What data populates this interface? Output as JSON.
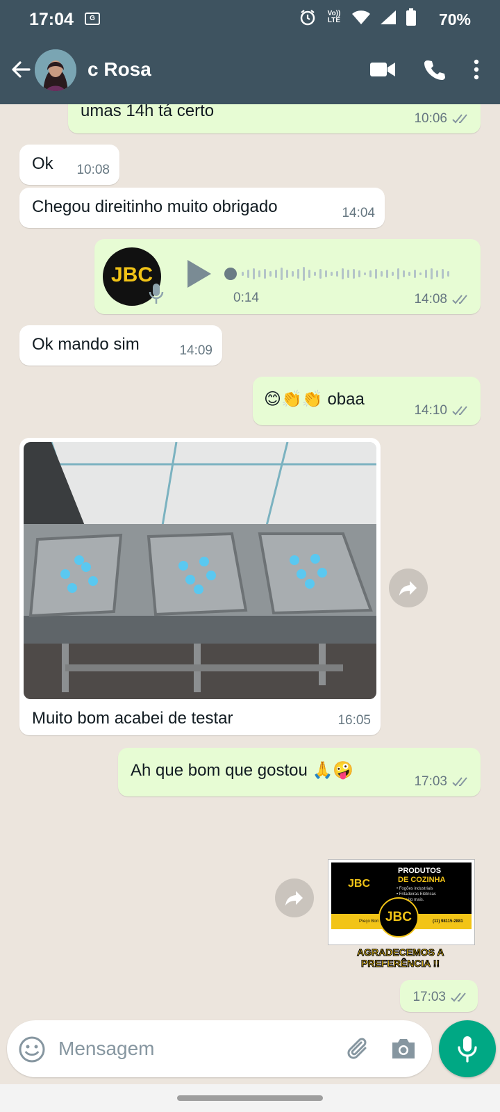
{
  "status_bar": {
    "time": "17:04",
    "battery_percent": "70%",
    "volte_label": "Vo)) LTE"
  },
  "header": {
    "contact_name": "c Rosa"
  },
  "messages": [
    {
      "id": "m1",
      "text": "umas 14h tá certo",
      "time": "10:06"
    },
    {
      "id": "m2",
      "text": "Ok",
      "time": "10:08"
    },
    {
      "id": "m3",
      "text": "Chegou direitinho muito obrigado",
      "time": "14:04"
    },
    {
      "id": "m4",
      "voice_duration": "0:14",
      "time": "14:08",
      "avatar_text": "JBC"
    },
    {
      "id": "m5",
      "text": "Ok mando sim",
      "time": "14:09"
    },
    {
      "id": "m6",
      "text": "😊👏👏 obaa",
      "time": "14:10"
    },
    {
      "id": "m7",
      "caption": "Muito bom acabei de testar",
      "time": "16:05"
    },
    {
      "id": "m8",
      "text": "Ah que bom que gostou 🙏🤪",
      "time": "17:03"
    },
    {
      "id": "m9",
      "sticker": {
        "logo": "JBC",
        "title_line1": "PRODUTOS",
        "title_line2": "DE COZINHA",
        "bullets": [
          "• Fogões industriais",
          "• Fritadeiras Elétricas",
          "• e muito mais."
        ],
        "phone": "(11) 98115-2881",
        "footer_left": "Preço Bom",
        "banner_line1": "AGRADECEMOS A",
        "banner_line2": "PREFERÊNCIA !!"
      }
    },
    {
      "id": "m10",
      "time": "17:03"
    }
  ],
  "composer": {
    "placeholder": "Mensagem"
  },
  "colors": {
    "header": "#3e5360",
    "chat_bg": "#ece5dd",
    "outgoing": "#e7fcd4",
    "incoming": "#ffffff",
    "mic_button": "#00a884",
    "tick_read": "#8696a0"
  },
  "icons": [
    "back-arrow-icon",
    "video-call-icon",
    "phone-icon",
    "more-vert-icon",
    "play-icon",
    "mic-icon",
    "forward-icon",
    "emoji-icon",
    "attach-icon",
    "camera-icon"
  ]
}
